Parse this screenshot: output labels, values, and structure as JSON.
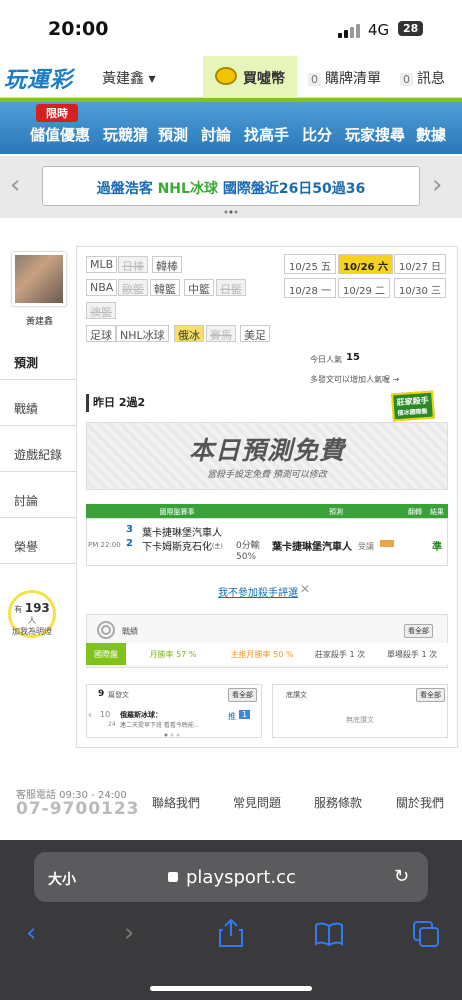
{
  "status": {
    "time": "20:00",
    "network": "4G",
    "battery": "28"
  },
  "topnav": {
    "logo": "玩運彩",
    "user": "黃建鑫 ▾",
    "buy": "買噓幣",
    "cart_count": "0",
    "cart": "購牌清單",
    "msg_count": "0",
    "msg": "訊息"
  },
  "menu": {
    "limited": "限時",
    "items": [
      "儲值優惠",
      "玩競猜",
      "預測",
      "討論",
      "找高手",
      "比分",
      "玩家搜尋",
      "數據"
    ]
  },
  "banner": {
    "prefix": "過盤浩客 ",
    "highlight": "NHL冰球",
    "suffix": " 國際盤近26日50過36"
  },
  "profile": {
    "name": "黃建鑫"
  },
  "sidebar": [
    "預測",
    "戰績",
    "遊戲紀錄",
    "討論",
    "榮譽"
  ],
  "popularity": {
    "prefix": "有",
    "count": "193",
    "unit": "人",
    "suffix": "加我為明燈"
  },
  "leagues": {
    "row1": [
      "MLB",
      "日棒",
      "韓棒"
    ],
    "row2": [
      "NBA",
      "歐籃",
      "韓籃",
      "中籃",
      "日籃"
    ],
    "row3": [
      "澳籃"
    ],
    "row4": [
      "足球",
      "NHL冰球",
      "俄冰",
      "賽馬",
      "美足"
    ]
  },
  "dates": [
    "10/25 五",
    "10/26 六",
    "10/27 日",
    "10/28 一",
    "10/29 二",
    "10/30 三"
  ],
  "today": {
    "label": "今日人氣",
    "value": "15",
    "note": "多發文可以增加人氣喔 →"
  },
  "result": {
    "title": "昨日 2過2",
    "badge1": "莊家殺手",
    "badge2": "俄冰國際盤"
  },
  "free": {
    "title": "本日預測免費",
    "sub": "當殺手設定免費 預測可以修改"
  },
  "table": {
    "headers": [
      "國際盤賽事",
      "預測",
      "翻轉",
      "結果"
    ],
    "time": "PM 22:00",
    "team1_no": "3",
    "team1": "葉卡捷琳堡汽車人",
    "team2_no": "2",
    "team2": "下卡姆斯克石化",
    "team2_tag": "(主)",
    "line": "0分輸",
    "pct": "50%",
    "pick": "葉卡捷琳堡汽車人",
    "pick_tag": "受讓",
    "result": "準"
  },
  "optout": "我不參加殺手評選",
  "stats": {
    "title": "戰績",
    "all": "看全部",
    "cells": [
      "國際盤",
      "月勝率 57 %",
      "主推月勝率 50 %",
      "莊家殺手 1 次",
      "單場殺手 1 次"
    ]
  },
  "posts": {
    "count": "9",
    "label": "篇發文",
    "all": "看全部",
    "month": "10",
    "day": "24",
    "title": "俄羅斯冰球：",
    "body": "連二天提早下班 看看今晚能...",
    "push": "推",
    "push_count": "1"
  },
  "gifts": {
    "label": "底讚文",
    "all": "看全部",
    "empty": "無底讚文"
  },
  "footer": {
    "hotline_label": "客服電話 09:30 - 24:00",
    "phone": "07-9700123",
    "links": [
      "聯絡我們",
      "常見問題",
      "服務條款",
      "關於我們"
    ]
  },
  "browser": {
    "text_size": "大小",
    "domain": "playsport.cc"
  }
}
